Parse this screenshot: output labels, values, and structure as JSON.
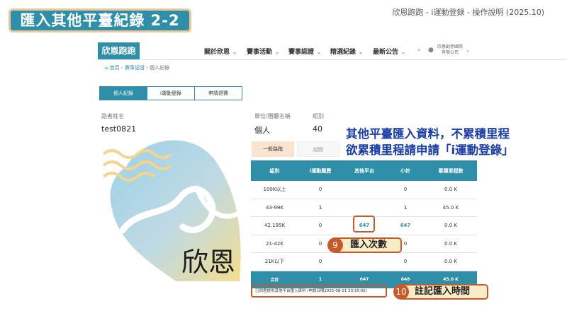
{
  "slide": {
    "title": "匯入其他平臺紀錄 2-2",
    "caption": "欣恩跑跑 - i運動登錄 - 操作說明 (2025.10)"
  },
  "site": {
    "logo": "欣恩跑跑",
    "nav": [
      "關於欣恩",
      "賽事活動",
      "賽事認證",
      "精選紀錄",
      "最新公告"
    ],
    "company": [
      "欣恩創意國際",
      "有限公司"
    ],
    "breadcrumb": {
      "home": "首頁",
      "level2": "賽事認證",
      "current": "個人紀錄"
    }
  },
  "tabs": [
    "個人紀錄",
    "i運動登錄",
    "申請退賽"
  ],
  "profile": {
    "name_label": "跑者姓名",
    "name_value": "test0821",
    "unit_label": "單位/團體名稱",
    "unit_value": "個人",
    "group_label": "組別",
    "group_value": "40"
  },
  "subtabs": [
    "一般路跑",
    "越野"
  ],
  "table": {
    "headers": [
      "組別",
      "i運動履歷",
      "其他平台",
      "小計",
      "累積里程數"
    ],
    "rows": [
      [
        "100K以上",
        "0",
        "",
        "0",
        "0.0 K"
      ],
      [
        "43-99K",
        "1",
        "",
        "1",
        "45.0 K"
      ],
      [
        "42.195K",
        "0",
        "647",
        "647",
        "0.0 K"
      ],
      [
        "21-42K",
        "0",
        "",
        "0",
        "0.0 K"
      ],
      [
        "21K以下",
        "0",
        "",
        "0",
        "0.0 K"
      ]
    ],
    "total": [
      "合計",
      "1",
      "647",
      "648",
      "45.0 K"
    ]
  },
  "note": "已同意提供其他平台匯入資料 (申請日期2025-08-21 23:55:05)",
  "annotation": {
    "line1": "其他平臺匯入資料，不累積里程",
    "line2": "欲累積里程請申請「i運動登錄」"
  },
  "callouts": [
    {
      "number": "9",
      "text": "匯入次數"
    },
    {
      "number": "10",
      "text": "註記匯入時間"
    }
  ],
  "decor": {
    "logo_text": "欣恩"
  },
  "colors": {
    "brand": "#2f8fa8",
    "highlight": "#c85a2a",
    "annotation": "#1a3ea8"
  }
}
